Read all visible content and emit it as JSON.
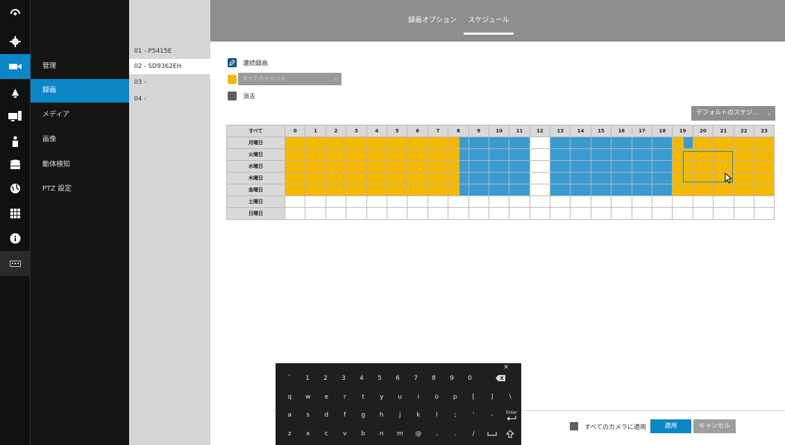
{
  "tabs": [
    {
      "label": "録画オプション",
      "active": false
    },
    {
      "label": "スケジュール",
      "active": true
    }
  ],
  "menu": {
    "items": [
      {
        "label": "管理",
        "active": false
      },
      {
        "label": "録画",
        "active": true
      },
      {
        "label": "メディア",
        "active": false
      },
      {
        "label": "画像",
        "active": false
      },
      {
        "label": "動体検知",
        "active": false
      },
      {
        "label": "PTZ 設定",
        "active": false
      }
    ]
  },
  "cameras": {
    "items": [
      {
        "label": "01 - P5415E",
        "active": false
      },
      {
        "label": "02 - SD9362EH",
        "active": true
      },
      {
        "label": "03 -",
        "active": false
      },
      {
        "label": "04 -",
        "active": false
      }
    ]
  },
  "legend": {
    "continuous": "連続録画",
    "event_placeholder": "すべてのイベント",
    "erase": "消去"
  },
  "template": {
    "value": "デフォルトのスケジ..."
  },
  "schedule": {
    "all_label": "すべて",
    "hours": [
      "0",
      "1",
      "2",
      "3",
      "4",
      "5",
      "6",
      "7",
      "8",
      "9",
      "10",
      "11",
      "12",
      "13",
      "14",
      "15",
      "16",
      "17",
      "18",
      "19",
      "20",
      "21",
      "22",
      "23"
    ],
    "days": [
      "月曜日",
      "火曜日",
      "水曜日",
      "木曜日",
      "金曜日",
      "土曜日",
      "日曜日"
    ]
  },
  "footer": {
    "apply_all": "すべてのカメラに適用",
    "apply": "適用",
    "cancel": "キャンセル"
  },
  "keyboard": {
    "close": "×",
    "enter": "Enter",
    "rows": [
      [
        "`",
        "1",
        "2",
        "3",
        "4",
        "5",
        "6",
        "7",
        "8",
        "9",
        "0"
      ],
      [
        "q",
        "w",
        "e",
        "r",
        "t",
        "y",
        "u",
        "i",
        "o",
        "p",
        "[",
        "]",
        "\\"
      ],
      [
        "a",
        "s",
        "d",
        "f",
        "g",
        "h",
        "j",
        "k",
        "l",
        ";",
        "'",
        "-"
      ],
      [
        "z",
        "x",
        "c",
        "v",
        "b",
        "n",
        "m",
        "@",
        ",",
        ".",
        "/"
      ]
    ]
  },
  "colors": {
    "accent": "#0b86c7",
    "continuous": "#f5b800",
    "event": "#3a9bd0",
    "erase": "#5e5e5e"
  }
}
